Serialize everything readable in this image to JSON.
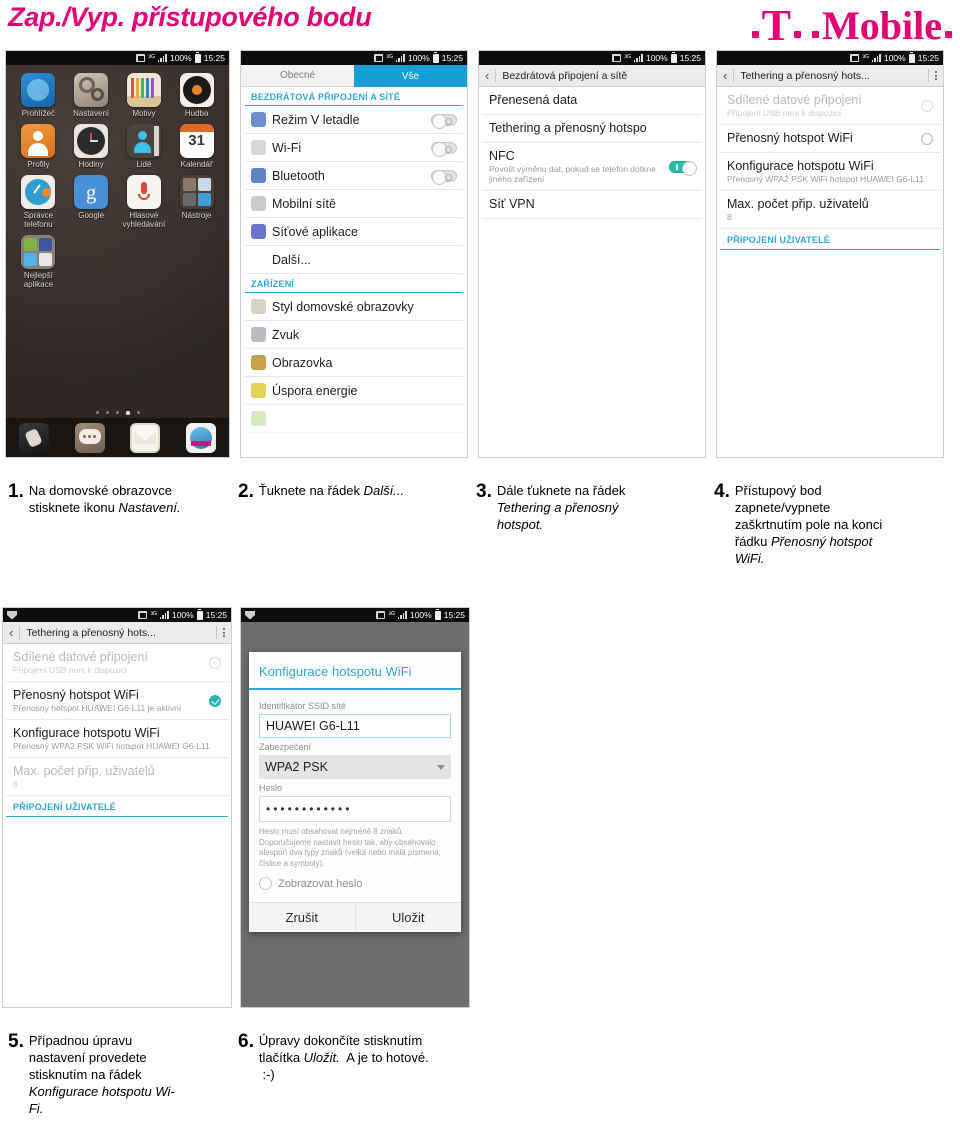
{
  "header": {
    "title": "Zap./Vyp. přístupového bodu",
    "brand": {
      "t": "T",
      "word": "Mobile",
      "color": "#e20074"
    }
  },
  "statusbar": {
    "battery": "100%",
    "time": "15:25"
  },
  "screens": {
    "home": {
      "apps": [
        {
          "label": "Prohlížeč",
          "icon": "browser-icon"
        },
        {
          "label": "Nastavení",
          "icon": "settings-icon"
        },
        {
          "label": "Motivy",
          "icon": "themes-icon"
        },
        {
          "label": "Hudba",
          "icon": "music-icon"
        },
        {
          "label": "Profily",
          "icon": "profiles-icon"
        },
        {
          "label": "Hodiny",
          "icon": "clock-icon"
        },
        {
          "label": "Lidé",
          "icon": "contacts-icon"
        },
        {
          "label": "Kalendář",
          "icon": "calendar-icon"
        },
        {
          "label": "Správce telefonu",
          "icon": "phone-manager-icon"
        },
        {
          "label": "Google",
          "icon": "google-icon"
        },
        {
          "label": "Hlasové vyhledávání",
          "icon": "voice-search-icon"
        },
        {
          "label": "Nástroje",
          "icon": "tools-folder-icon"
        },
        {
          "label": "Nejlepší aplikace",
          "icon": "best-apps-folder-icon"
        }
      ],
      "calendar_day": "31",
      "google_letter": "g",
      "dock": [
        {
          "icon": "phone-icon"
        },
        {
          "icon": "messages-icon"
        },
        {
          "icon": "email-icon"
        },
        {
          "icon": "browser-dock-icon"
        }
      ],
      "page_dots": 5,
      "active_dot": 4
    },
    "settings": {
      "tabs": [
        {
          "label": "Obecné",
          "active": false
        },
        {
          "label": "Vše",
          "active": true
        }
      ],
      "section_wireless": "BEZDRÁTOVÁ PŘIPOJENÍ A SÍTĚ",
      "rows_wireless": [
        {
          "label": "Režim V letadle",
          "icon": "airplane-icon",
          "toggle": "off"
        },
        {
          "label": "Wi-Fi",
          "icon": "wifi-icon",
          "toggle": "off"
        },
        {
          "label": "Bluetooth",
          "icon": "bluetooth-icon",
          "toggle": "off"
        },
        {
          "label": "Mobilní sítě",
          "icon": "mobile-networks-icon",
          "toggle": null
        },
        {
          "label": "Síťové aplikace",
          "icon": "network-apps-icon",
          "toggle": null
        },
        {
          "label": "Další...",
          "icon": null,
          "toggle": null
        }
      ],
      "section_device": "ZAŘÍZENÍ",
      "rows_device": [
        {
          "label": "Styl domovské obrazovky",
          "icon": "home-style-icon"
        },
        {
          "label": "Zvuk",
          "icon": "sound-icon"
        },
        {
          "label": "Obrazovka",
          "icon": "display-icon"
        },
        {
          "label": "Úspora energie",
          "icon": "battery-saver-icon"
        }
      ]
    },
    "wireless": {
      "toolbar_title": "Bezdrátová připojení a sítě",
      "items": [
        {
          "title": "Přenesená data",
          "sub": null,
          "toggle": null
        },
        {
          "title": "Tethering a přenosný hotspo",
          "sub": null,
          "toggle": null
        },
        {
          "title": "NFC",
          "sub": "Povolit výměnu dat, pokud se telefon dotkne jiného zařízení",
          "toggle": "on"
        },
        {
          "title": "Síť VPN",
          "sub": null,
          "toggle": null
        }
      ]
    },
    "tethering_off": {
      "toolbar_title": "Tethering a přenosný hots...",
      "items": [
        {
          "title": "Sdílené datové připojení",
          "sub": "Připojení USB není k dispozici",
          "dim": true,
          "radio": "dim"
        },
        {
          "title": "Přenosný hotspot WiFi",
          "sub": null,
          "dim": false,
          "radio": "empty"
        },
        {
          "title": "Konfigurace hotspotu WiFi",
          "sub": "Přenosný WPA2 PSK WiFi hotspot HUAWEI G6-L11",
          "dim": false,
          "radio": null
        },
        {
          "title": "Max. počet přip. uživatelů",
          "sub": "8",
          "dim": false,
          "radio": null
        }
      ],
      "users_header": "PŘIPOJENÍ UŽIVATELÉ"
    },
    "tethering_on": {
      "toolbar_title": "Tethering a přenosný hots...",
      "items": [
        {
          "title": "Sdílené datové připojení",
          "sub": "Připojení USB není k dispozici",
          "dim": true,
          "radio": "dim"
        },
        {
          "title": "Přenosný hotspot WiFi",
          "sub": "Přenosný hotspot HUAWEI G6-L11 je aktivní",
          "dim": false,
          "radio": "checked"
        },
        {
          "title": "Konfigurace hotspotu WiFi",
          "sub": "Přenosný WPA2 PSK WiFi hotspot HUAWEI G6-L11",
          "dim": false,
          "radio": null
        },
        {
          "title": "Max. počet přip. uživatelů",
          "sub": "8",
          "dim": true,
          "radio": null
        }
      ],
      "users_header": "PŘIPOJENÍ UŽIVATELÉ"
    },
    "config_dialog": {
      "toolbar_title": "Tethering a přenosný hots...",
      "dialog_title": "Konfigurace hotspotu WiFi",
      "ssid_label": "Identifikátor SSID sítě",
      "ssid_value": "HUAWEI G6-L11",
      "security_label": "Zabezpečení",
      "security_value": "WPA2 PSK",
      "password_label": "Heslo",
      "password_value": "••••••••••••",
      "hint": "Heslo musí obsahovat nejméně 8 znaků. Doporučujeme nastavit heslo tak, aby obsahovalo alespoň dva typy znaků (velká nebo malá písmena, číslice a symboly).",
      "show_password_label": "Zobrazovat heslo",
      "cancel_label": "Zrušit",
      "save_label": "Uložit"
    }
  },
  "steps": [
    {
      "num": "1.",
      "parts": [
        {
          "t": "Na domovské obrazovce stisknete ikonu ",
          "i": false
        },
        {
          "t": "Nastavení.",
          "i": true
        }
      ]
    },
    {
      "num": "2.",
      "parts": [
        {
          "t": "Ťuknete na řádek ",
          "i": false
        },
        {
          "t": "Další...",
          "i": true
        }
      ]
    },
    {
      "num": "3.",
      "parts": [
        {
          "t": "Dále ťuknete na řádek ",
          "i": false
        },
        {
          "t": "Tethering a přenosný hotspot.",
          "i": true
        }
      ]
    },
    {
      "num": "4.",
      "parts": [
        {
          "t": "Přístupový bod zapnete/vypnete zaškrtnutím pole na konci řádku ",
          "i": false
        },
        {
          "t": "Přenosný hotspot WiFi.",
          "i": true
        }
      ]
    },
    {
      "num": "5.",
      "parts": [
        {
          "t": "Případnou úpravu nastavení provedete stisknutím na řádek ",
          "i": false
        },
        {
          "t": "Konfigurace hotspotu Wi-Fi.",
          "i": true
        }
      ]
    },
    {
      "num": "6.",
      "parts": [
        {
          "t": "Úpravy dokončíte stisknutím tlačítka ",
          "i": false
        },
        {
          "t": "Uložit.",
          "i": true
        },
        {
          "t": "  A je to hotové.  :-)",
          "i": false
        }
      ]
    }
  ]
}
